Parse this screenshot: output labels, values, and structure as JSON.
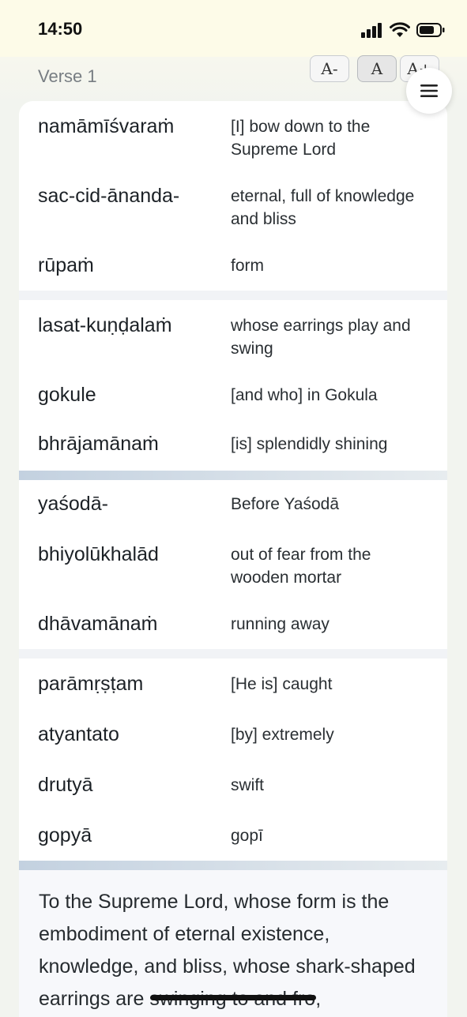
{
  "status": {
    "time": "14:50"
  },
  "header": {
    "verse_label": "Verse 1",
    "font_decrease": "A-",
    "font_default": "A",
    "font_increase": "A+"
  },
  "groups": [
    {
      "rows": [
        {
          "word": "namāmīśvaraṁ",
          "meaning": "[I] bow down to the Supreme Lord"
        },
        {
          "word": "sac-cid-ānanda-",
          "meaning": "eternal, full of knowledge and bliss"
        },
        {
          "word": "rūpaṁ",
          "meaning": "form"
        }
      ]
    },
    {
      "rows": [
        {
          "word": "lasat-kuṇḍalaṁ",
          "meaning": "whose earrings play and swing"
        },
        {
          "word": "gokule",
          "meaning": "[and who] in Gokula"
        },
        {
          "word": "bhrājamānaṁ",
          "meaning": "[is] splendidly shining"
        }
      ]
    },
    {
      "rows": [
        {
          "word": "yaśodā-",
          "meaning": "Before Yaśodā"
        },
        {
          "word": "bhiyolūkhalād",
          "meaning": "out of fear from the wooden mortar"
        },
        {
          "word": "dhāvamānaṁ",
          "meaning": "running away"
        }
      ]
    },
    {
      "rows": [
        {
          "word": "parāmṛṣṭam",
          "meaning": "[He is] caught"
        },
        {
          "word": "atyantato",
          "meaning": "[by] extremely"
        },
        {
          "word": "drutyā",
          "meaning": "swift"
        },
        {
          "word": "gopyā",
          "meaning": "gopī"
        }
      ]
    }
  ],
  "translation": "To the Supreme Lord, whose form is the embodiment of eternal existence, knowledge, and bliss, whose shark-shaped earrings are swinging to and fro,"
}
